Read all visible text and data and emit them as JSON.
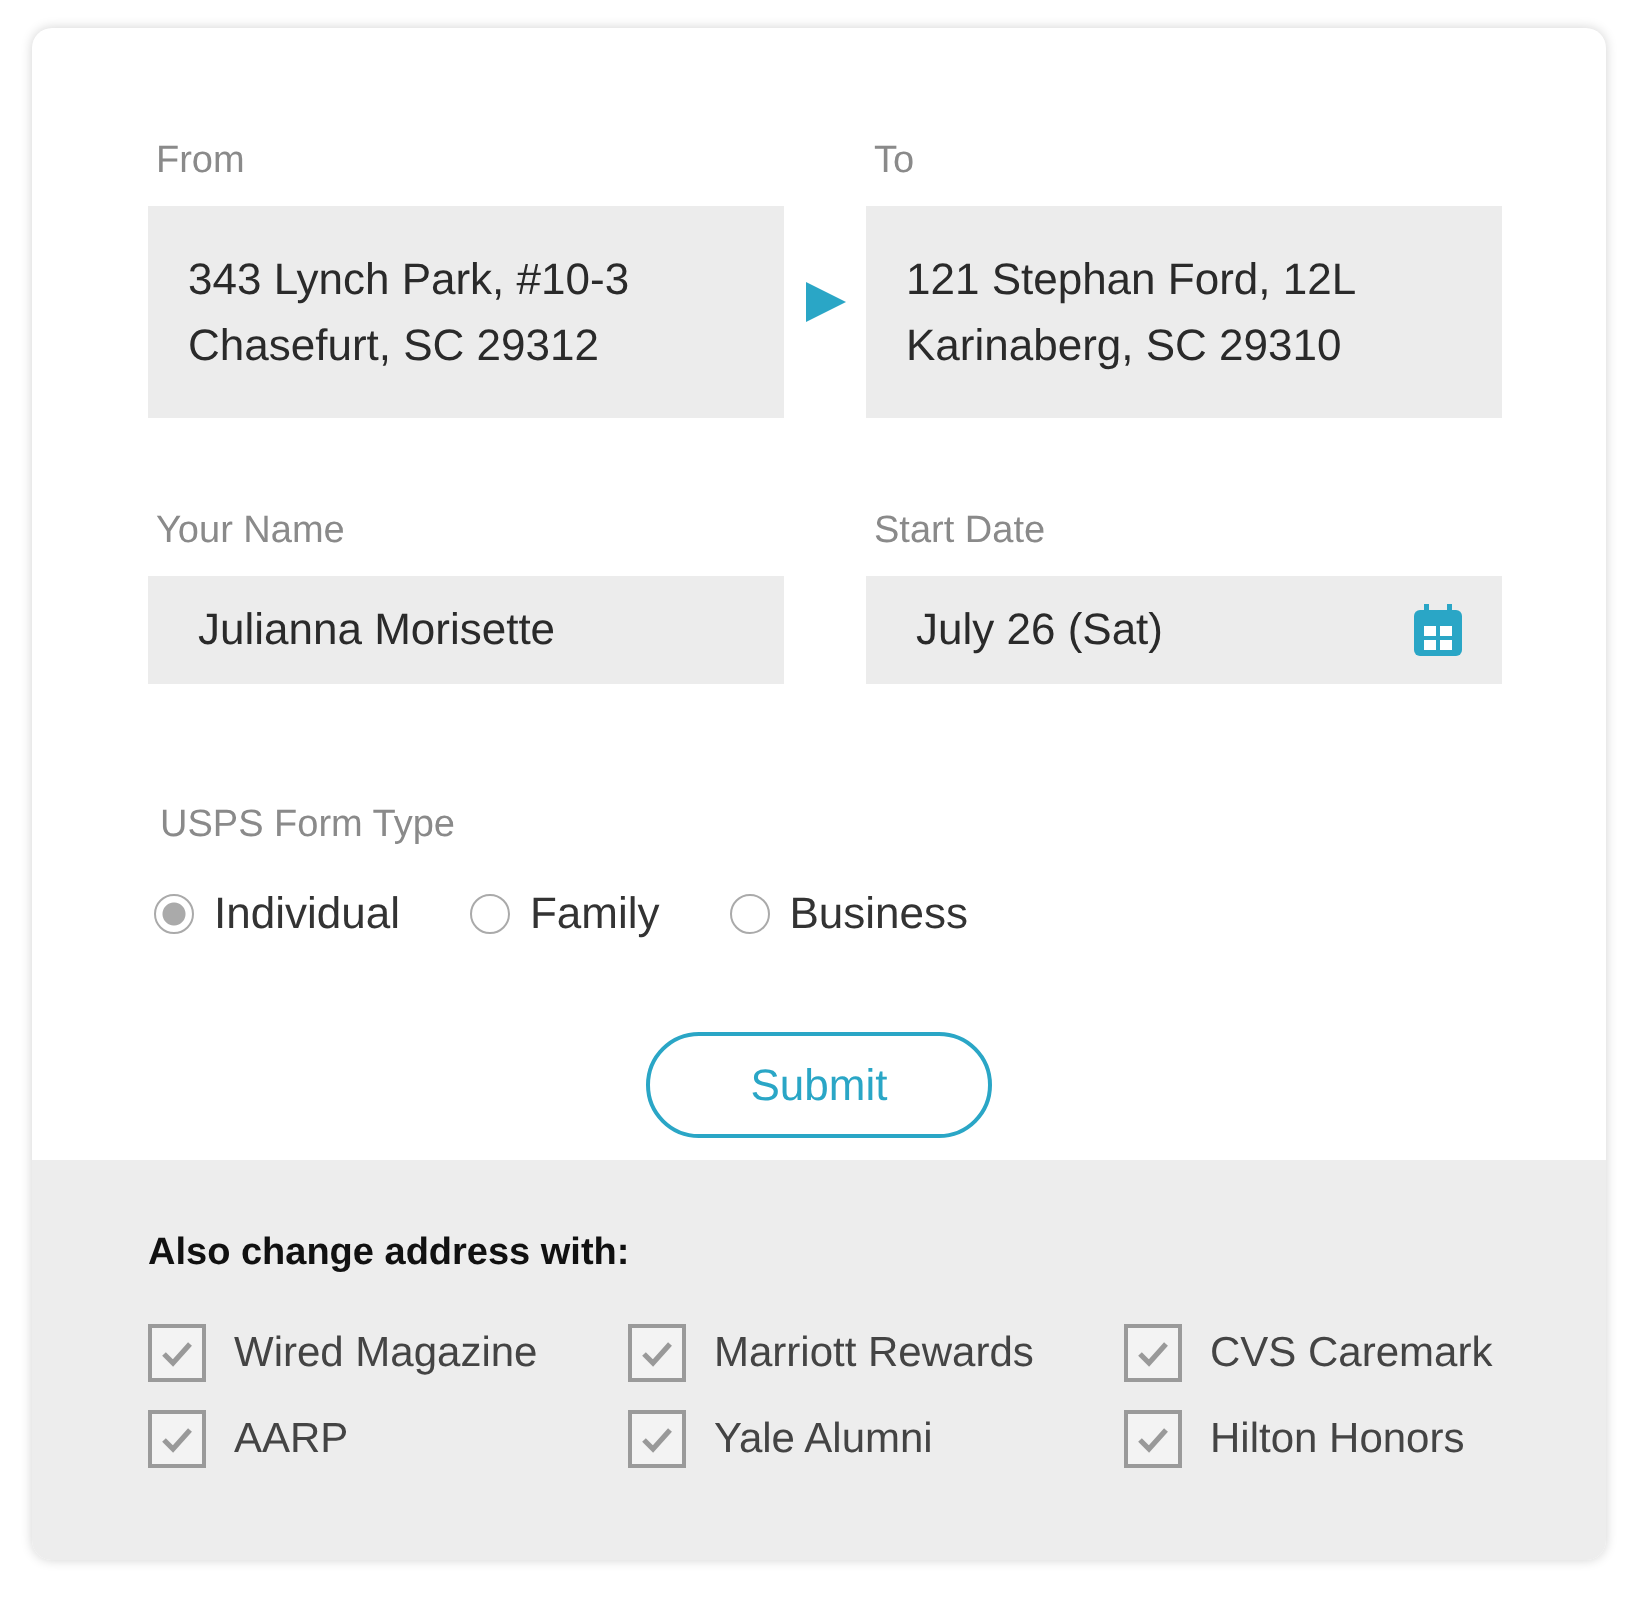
{
  "addresses": {
    "from": {
      "label": "From",
      "value": "343 Lynch Park, #10-3\nChasefurt, SC 29312"
    },
    "to": {
      "label": "To",
      "value": "121 Stephan Ford, 12L\nKarinaberg, SC 29310"
    }
  },
  "name_field": {
    "label": "Your Name",
    "value": "Julianna Morisette"
  },
  "date_field": {
    "label": "Start Date",
    "value": "July 26 (Sat)"
  },
  "form_type": {
    "label": "USPS Form Type",
    "options": [
      {
        "label": "Individual",
        "selected": true
      },
      {
        "label": "Family",
        "selected": false
      },
      {
        "label": "Business",
        "selected": false
      }
    ]
  },
  "submit": "Submit",
  "also_change": {
    "title": "Also change address with:",
    "items": [
      {
        "label": "Wired Magazine",
        "checked": true
      },
      {
        "label": "Marriott Rewards",
        "checked": true
      },
      {
        "label": "CVS Caremark",
        "checked": true
      },
      {
        "label": "AARP",
        "checked": true
      },
      {
        "label": "Yale Alumni",
        "checked": true
      },
      {
        "label": "Hilton Honors",
        "checked": true
      }
    ]
  }
}
